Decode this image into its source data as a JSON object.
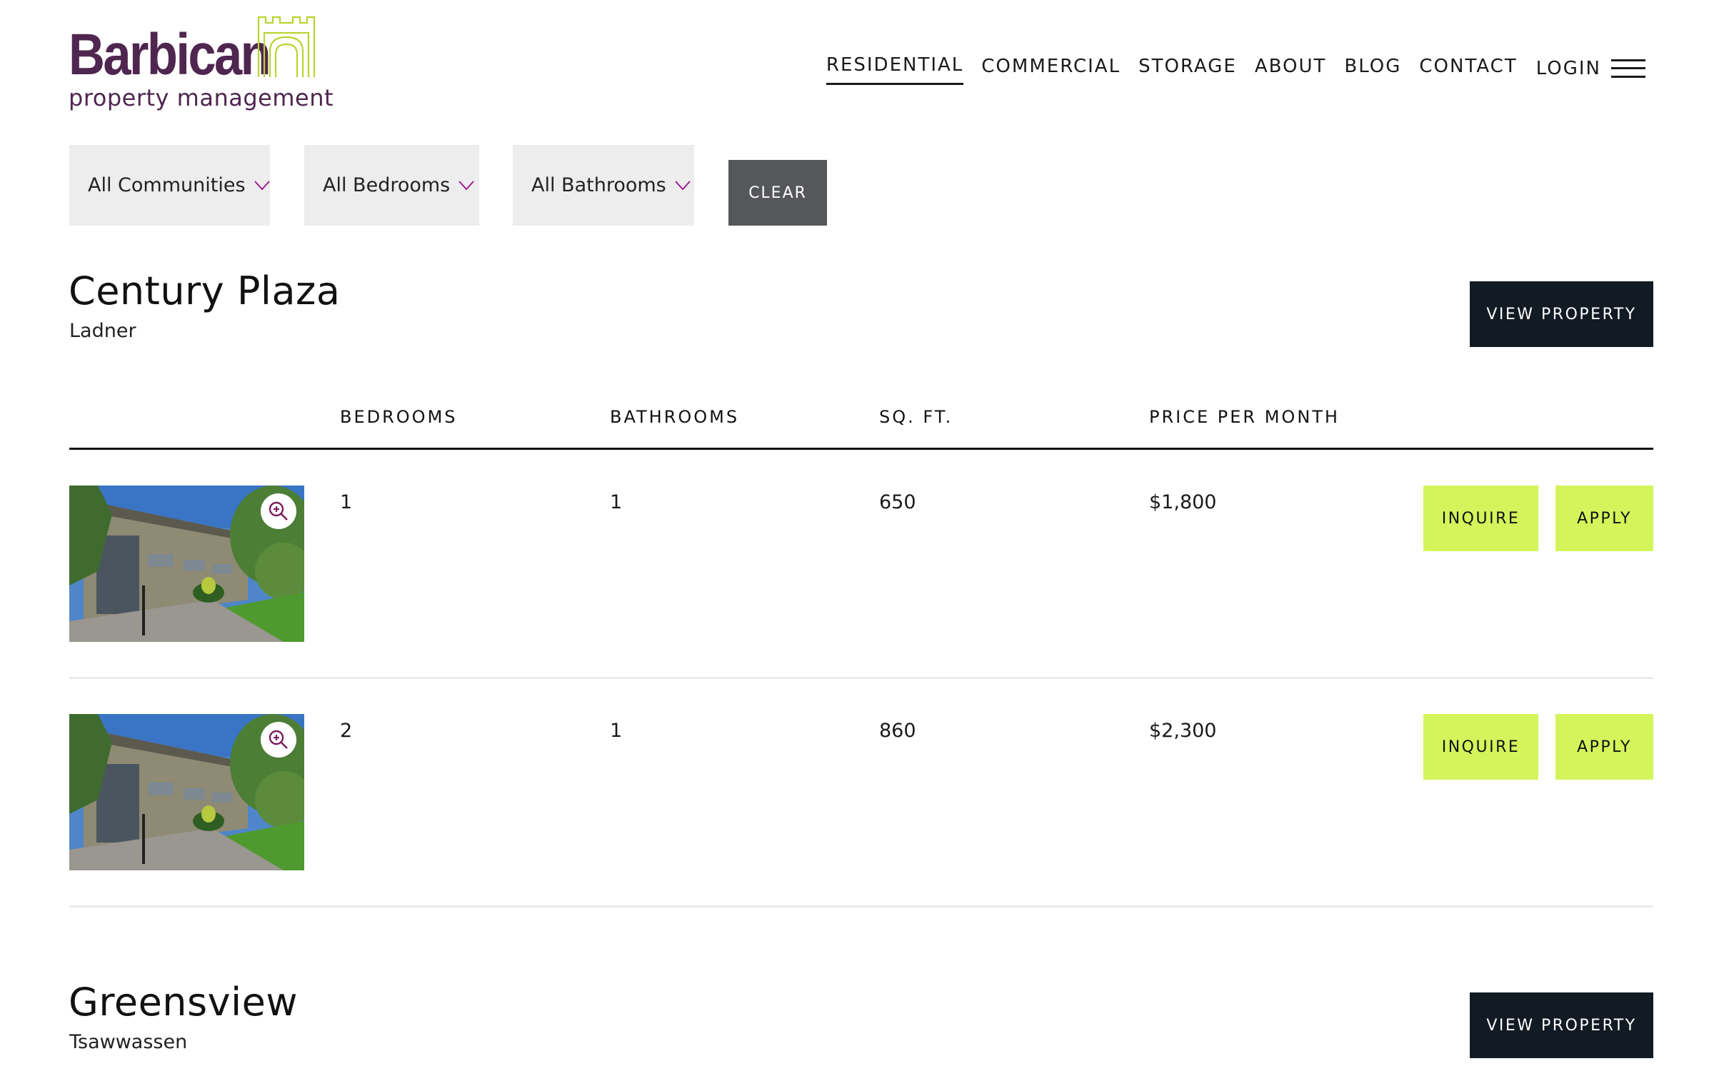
{
  "brand": {
    "name": "Barbican",
    "tagline": "property management",
    "primary_color": "#4f2650",
    "accent_color": "#b9d430"
  },
  "nav": {
    "items": [
      "RESIDENTIAL",
      "COMMERCIAL",
      "STORAGE",
      "ABOUT",
      "BLOG",
      "CONTACT"
    ],
    "active": "RESIDENTIAL",
    "login": "LOGIN",
    "menu_icon": "hamburger-icon"
  },
  "filters": {
    "communities": "All Communities",
    "bedrooms": "All Bedrooms",
    "bathrooms": "All Bathrooms",
    "clear": "CLEAR",
    "chevron_icon": "chevron-down-icon",
    "chevron_color": "#a0208f"
  },
  "table": {
    "columns": [
      "BEDROOMS",
      "BATHROOMS",
      "SQ. FT.",
      "PRICE PER MONTH"
    ]
  },
  "properties": [
    {
      "name": "Century Plaza",
      "location": "Ladner",
      "view_label": "VIEW PROPERTY",
      "units": [
        {
          "bedrooms": "1",
          "bathrooms": "1",
          "sqft": "650",
          "price": "$1,800",
          "inquire": "INQUIRE",
          "apply": "APPLY"
        },
        {
          "bedrooms": "2",
          "bathrooms": "1",
          "sqft": "860",
          "price": "$2,300",
          "inquire": "INQUIRE",
          "apply": "APPLY"
        }
      ]
    },
    {
      "name": "Greensview",
      "location": "Tsawwassen",
      "view_label": "VIEW PROPERTY",
      "units": []
    }
  ],
  "colors": {
    "dark_button": "#121a23",
    "clear_button": "#56575b",
    "lime_button": "#d3f55b",
    "filter_bg": "#ededed"
  }
}
